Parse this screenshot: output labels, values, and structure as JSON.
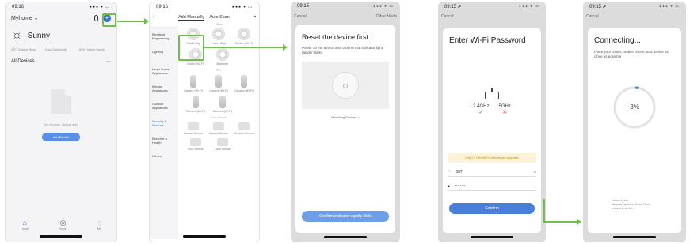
{
  "phone1": {
    "status": {
      "time": "09:16",
      "icons": "●●● ▾ ▭"
    },
    "home_name": "Myhome ⌄",
    "weather": {
      "label": "Sunny",
      "stats": [
        "25°C Outdoor Temp",
        "Good Outdoor Air",
        "65% Outdoor Humid"
      ]
    },
    "devices_title": "All Devices",
    "devices_more": "···",
    "empty_text": "No devices, please add",
    "add_button": "Add Device",
    "tabs": [
      "Home",
      "Smart",
      "Me"
    ]
  },
  "phone2": {
    "status": {
      "time": "09:16",
      "icons": "●●● ▾ ▭"
    },
    "back": "‹",
    "tabs": [
      "Add Manually",
      "Auto Scan"
    ],
    "sub": "Scan",
    "scan_icon": "⌗",
    "sidebar": [
      "Electrical Engineering",
      "Lighting",
      "Large Home Appliances",
      "Kitchen Appliances",
      "Outdoor Appliances",
      "Security & Sensors",
      "Exercise & Health",
      "Others"
    ],
    "row1": [
      "Smart Plug",
      "Power Strip",
      "Socket (Wi-Fi)"
    ],
    "row2": [
      "Switch (Wi-Fi)",
      "Bluetooth"
    ],
    "section_ipc": "IPC",
    "row3": [
      "Camera (Wi-Fi)",
      "Camera (Wi-Fi)",
      "Camera (Wi-Fi)"
    ],
    "row4": [
      "Camera (Wi-Fi)",
      "Camera (Wi-Fi)"
    ],
    "section_sensor": "Door Sensor",
    "row5": [
      "Contact Sensor",
      "Contact Sensor",
      "Contact Sensor"
    ],
    "row6": [
      "Door Sensor",
      "Door Sensor"
    ]
  },
  "phone3": {
    "status": {
      "time": "09:15",
      "icons": "●●● ▾ ▭"
    },
    "cancel": "Cancel",
    "other_mode": "Other Mode",
    "title": "Reset the device first.",
    "desc": "Power on the device and confirm that indicator light rapidly blinks.",
    "reset_link": "Resetting Devices >",
    "confirm": "Confirm indicator rapidly blink"
  },
  "phone4": {
    "status": {
      "time": "09:15 ⬈",
      "icons": "●●● ▾ ▭"
    },
    "cancel": "Cancel",
    "title": "Enter Wi-Fi Password",
    "band_24": "2.4GHz",
    "band_5": "5GHz",
    "note": "Only 2.4 GHz Wi-Fi networks are supported",
    "ssid": "007",
    "ssid_action": "⇄",
    "password": "••••••••",
    "password_action": "◡",
    "confirm": "Confirm"
  },
  "phone5": {
    "status": {
      "time": "09:15 ⬈",
      "icons": "●●● ▾ ▭"
    },
    "cancel": "Cancel",
    "title": "Connecting...",
    "desc": "Place your router, mobile phone, and device as close as possible",
    "progress_text": "3%",
    "progress": 0.03,
    "found_lines": [
      "Device found",
      "Register Device to Smart Cloud",
      "Initializing device..."
    ]
  },
  "colors": {
    "accent_green": "#6fbf4a",
    "primary_blue": "#2f6fe0"
  }
}
